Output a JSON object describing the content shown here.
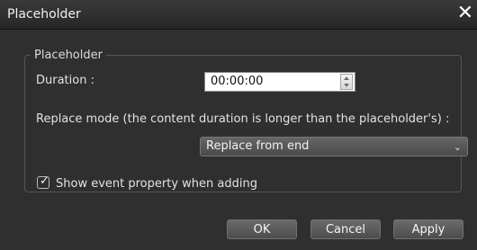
{
  "window": {
    "title": "Placeholder",
    "close_glyph": "✕"
  },
  "group": {
    "legend": "Placeholder",
    "duration_label": "Duration :",
    "duration_value": "00:00:00",
    "replace_mode_label": "Replace mode (the content duration is longer than the placeholder's) :",
    "replace_mode_selected": "Replace from end",
    "show_event_label": "Show event property when adding",
    "show_event_checked": true
  },
  "buttons": {
    "ok": "OK",
    "cancel": "Cancel",
    "apply": "Apply"
  },
  "icons": {
    "close": "close-icon",
    "spin": "spin-arrows-icon",
    "dropdown": "chevron-down-icon",
    "check": "check-icon"
  }
}
